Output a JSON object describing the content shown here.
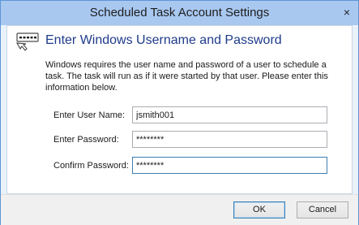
{
  "window": {
    "title": "Scheduled Task Account Settings",
    "close_glyph": "×"
  },
  "header": {
    "icon": "password-key-icon",
    "title": "Enter Windows Username and Password"
  },
  "description": "Windows requires the user name and password of a user to schedule a task.  The task will run as if it were started by that user.  Please enter this information below.",
  "form": {
    "username": {
      "label": "Enter User Name:",
      "value": "jsmith001"
    },
    "password": {
      "label": "Enter Password:",
      "value": "********"
    },
    "confirm": {
      "label": "Confirm Password:",
      "value": "********"
    }
  },
  "buttons": {
    "ok": "OK",
    "cancel": "Cancel"
  },
  "colors": {
    "heading": "#1f3b8a",
    "titlebar": "#a8c8f0",
    "frame": "#e9f1fa",
    "focus_border": "#3c7fb1"
  }
}
